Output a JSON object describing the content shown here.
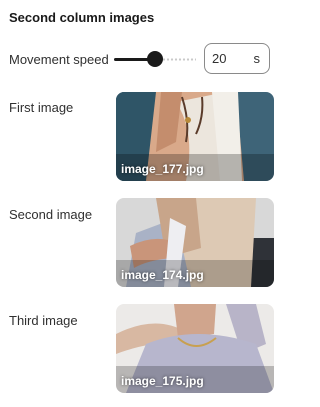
{
  "section": {
    "title": "Second column images"
  },
  "speed": {
    "label": "Movement speed",
    "value": "20",
    "unit": "s",
    "slider_fraction": 0.5
  },
  "images": [
    {
      "label": "First image",
      "filename": "image_177.jpg"
    },
    {
      "label": "Second image",
      "filename": "image_174.jpg"
    },
    {
      "label": "Third image",
      "filename": "image_175.jpg"
    }
  ],
  "colors": {
    "accent": "#1a1a1a",
    "border": "#8a8a8a"
  }
}
